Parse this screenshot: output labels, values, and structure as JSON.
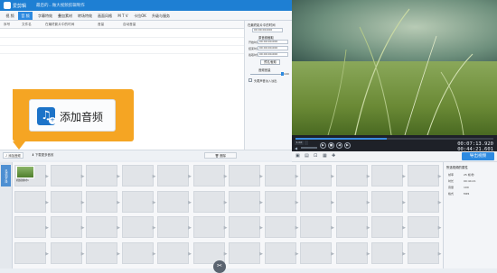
{
  "titlebar": {
    "app": "爱剪辑",
    "doc": "最后的...做大视频剪辑制作",
    "controls": [
      "─",
      "□",
      "✕"
    ]
  },
  "tabs": [
    {
      "label": "视 频"
    },
    {
      "label": "音 频"
    },
    {
      "label": "字幕特效"
    },
    {
      "label": "叠加素材"
    },
    {
      "label": "转场特效"
    },
    {
      "label": "画面风格"
    },
    {
      "label": "M T V"
    },
    {
      "label": "卡拉OK"
    },
    {
      "label": "升级与服务"
    }
  ],
  "list_headers": [
    "序号",
    "文件名",
    "在最终影片中的时间",
    "音量",
    "自动音量"
  ],
  "right_panel": {
    "section1": "截取原音频文件",
    "section1b": "原音频截取",
    "section2": "在最终影片中的时间",
    "fields": [
      {
        "label": "开始时间",
        "value": "00:00:00.000"
      },
      {
        "label": "结束时间",
        "value": "00:00:00.000"
      },
      {
        "label": "截取时长",
        "value": "00:00:00.000"
      }
    ],
    "confirm": "确认修改",
    "preview": "预览/截取",
    "volume_title": "音频音量",
    "volume_value": "100",
    "checkbox_label": "头尾声音淡入淡出"
  },
  "bottom_buttons": {
    "add_audio": "添加音频",
    "download_audio": "下载更多音效",
    "delete": "删除"
  },
  "player": {
    "speed": "1.0X",
    "current": "00:07:13.920",
    "total": "00:44:21.601",
    "progress_fraction": 0.46
  },
  "export_label": "导出视频",
  "timeline": {
    "side_tab": "已添加片段",
    "first_clip": "视频素材1"
  },
  "properties": {
    "title": "所选视频的属性",
    "rows": [
      {
        "k": "帧率",
        "v": "25 帧/秒"
      },
      {
        "k": "时长",
        "v": "00:44:21"
      },
      {
        "k": "音量",
        "v": "100"
      },
      {
        "k": "格式",
        "v": "MP4"
      }
    ]
  },
  "callout": {
    "label": "添加音频"
  },
  "colors": {
    "accent": "#2d8ae0",
    "callout": "#f5a523"
  }
}
